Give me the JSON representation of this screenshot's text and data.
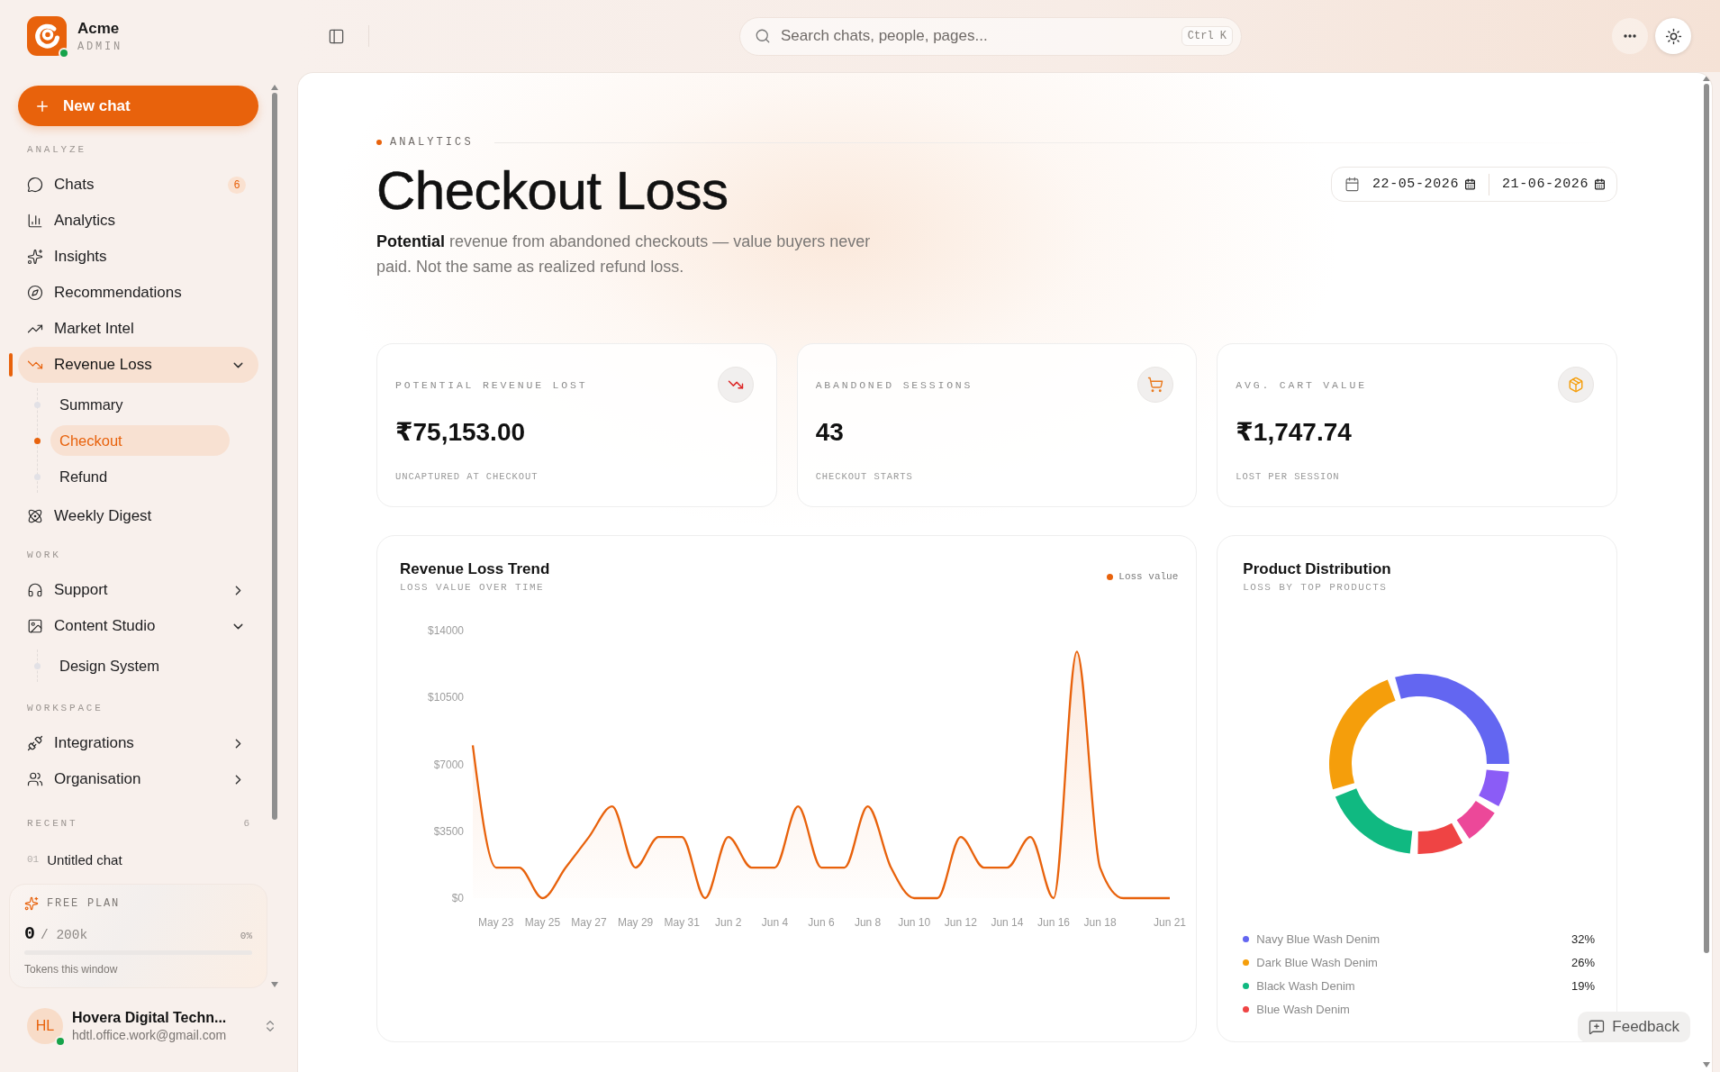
{
  "sidebar": {
    "brand": {
      "name": "Acme",
      "role": "ADMIN",
      "online": true
    },
    "new_chat": {
      "label": "New chat"
    },
    "sections": [
      {
        "label": "ANALYZE",
        "items": [
          {
            "label": "Chats",
            "badge": "6",
            "selected": false
          },
          {
            "label": "Analytics",
            "selected": false
          },
          {
            "label": "Insights",
            "selected": false
          },
          {
            "label": "Recommendations",
            "selected": false
          },
          {
            "label": "Market Intel",
            "selected": false
          },
          {
            "label": "Revenue Loss",
            "selected": true,
            "expanded": true,
            "children": [
              {
                "label": "Summary",
                "selected": false
              },
              {
                "label": "Checkout",
                "selected": true
              },
              {
                "label": "Refund",
                "selected": false
              }
            ]
          },
          {
            "label": "Weekly Digest",
            "selected": false
          }
        ]
      },
      {
        "label": "WORK",
        "items": [
          {
            "label": "Support",
            "selected": false,
            "expanded": false
          },
          {
            "label": "Content Studio",
            "selected": false,
            "expanded": true,
            "children": [
              {
                "label": "Design System",
                "selected": false
              }
            ]
          }
        ]
      },
      {
        "label": "WORKSPACE",
        "items": [
          {
            "label": "Integrations",
            "selected": false,
            "expanded": false
          },
          {
            "label": "Organisation",
            "selected": false,
            "expanded": false
          }
        ]
      }
    ],
    "recent": {
      "label": "RECENT",
      "count": "6",
      "items": [
        {
          "number": "01",
          "title": "Untitled chat"
        }
      ]
    },
    "plan": {
      "label": "FREE PLAN",
      "used": "0",
      "limit": "/ 200k",
      "percent": "0%",
      "caption": "Tokens this window"
    },
    "user": {
      "initials": "HL",
      "name": "Hovera Digital Techn...",
      "email": "hdtl.office.work@gmail.com",
      "online": true
    }
  },
  "topbar": {
    "search": {
      "placeholder": "Search chats, people, pages...",
      "shortcut": "Ctrl K"
    }
  },
  "header": {
    "eyebrow": "ANALYTICS",
    "title": "Checkout Loss",
    "description": "**Potential** revenue from abandoned checkouts — value buyers never paid. Not the same as realized refund loss.",
    "date_range": {
      "start": "22-05-2026",
      "end": "21-06-2026"
    }
  },
  "stats": [
    {
      "label": "POTENTIAL REVENUE LOST",
      "value": "₹75,153.00",
      "caption": "UNCAPTURED AT CHECKOUT"
    },
    {
      "label": "ABANDONED SESSIONS",
      "value": "43",
      "caption": "CHECKOUT STARTS"
    },
    {
      "label": "AVG. CART VALUE",
      "value": "₹1,747.74",
      "caption": "LOST PER SESSION"
    }
  ],
  "trend": {
    "subtitle": "LOSS VALUE OVER TIME",
    "chart_data": {
      "type": "area",
      "title": "Revenue Loss Trend",
      "categories": [
        null,
        "May 23",
        null,
        "May 25",
        null,
        "May 27",
        null,
        "May 29",
        null,
        "May 31",
        null,
        "Jun 2",
        null,
        "Jun 4",
        null,
        "Jun 6",
        null,
        "Jun 8",
        null,
        "Jun 10",
        null,
        "Jun 12",
        null,
        "Jun 14",
        null,
        "Jun 16",
        null,
        "Jun 18",
        null,
        null,
        "Jun 21"
      ],
      "ylim": [
        0,
        14000
      ],
      "yticks": [
        {
          "value": 0,
          "label": "$0"
        },
        {
          "value": 3500,
          "label": "$3500"
        },
        {
          "value": 7000,
          "label": "$7000"
        },
        {
          "value": 10500,
          "label": "$10500"
        },
        {
          "value": 14000,
          "label": "$14000"
        }
      ],
      "series": [
        {
          "name": "Loss value",
          "color": "#e8620c",
          "values": [
            8000,
            1600,
            1600,
            0,
            1600,
            3200,
            4800,
            1600,
            3200,
            3200,
            0,
            3200,
            1600,
            1600,
            4800,
            1600,
            1600,
            4800,
            1600,
            0,
            0,
            3200,
            1600,
            1600,
            3200,
            0,
            12900,
            1600,
            0,
            0,
            0
          ]
        }
      ]
    }
  },
  "distribution": {
    "subtitle": "LOSS BY TOP PRODUCTS",
    "chart_data": {
      "type": "donut",
      "title": "Product Distribution",
      "categories": [
        "Navy Blue Wash Denim",
        "Dark Blue Wash Denim",
        "Black Wash Denim",
        "Blue Wash Denim",
        null,
        null
      ],
      "values": [
        32,
        26,
        19,
        9,
        7,
        7
      ],
      "colors": [
        "#6366f1",
        "#f59e0b",
        "#10b981",
        "#ef4444",
        "#ec4899",
        "#8b5cf6"
      ]
    },
    "shares": [
      "32%",
      "26%",
      "19%"
    ]
  },
  "feedback": {
    "label": "Feedback"
  }
}
